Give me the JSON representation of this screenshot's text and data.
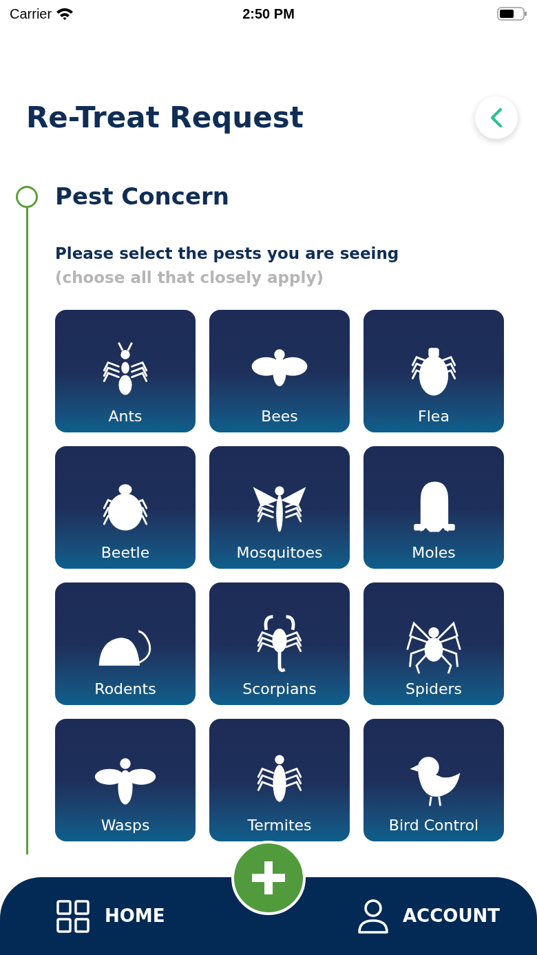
{
  "status_bar": {
    "carrier": "Carrier",
    "time": "2:50 PM"
  },
  "header": {
    "title": "Re-Treat Request"
  },
  "step": {
    "title": "Pest Concern",
    "prompt": "Please select the pests you are seeing",
    "hint": "(choose all that closely apply)"
  },
  "pests": [
    {
      "label": "Ants",
      "selected": false
    },
    {
      "label": "Bees",
      "selected": false
    },
    {
      "label": "Flea",
      "selected": false
    },
    {
      "label": "Beetle",
      "selected": false
    },
    {
      "label": "Mosquitoes",
      "selected": false
    },
    {
      "label": "Moles",
      "selected": false
    },
    {
      "label": "Rodents",
      "selected": false
    },
    {
      "label": "Scorpians",
      "selected": false
    },
    {
      "label": "Spiders",
      "selected": false
    },
    {
      "label": "Wasps",
      "selected": false
    },
    {
      "label": "Termites",
      "selected": false
    },
    {
      "label": "Bird Control",
      "selected": false
    }
  ],
  "bottom_nav": {
    "home": "HOME",
    "account": "ACCOUNT"
  }
}
